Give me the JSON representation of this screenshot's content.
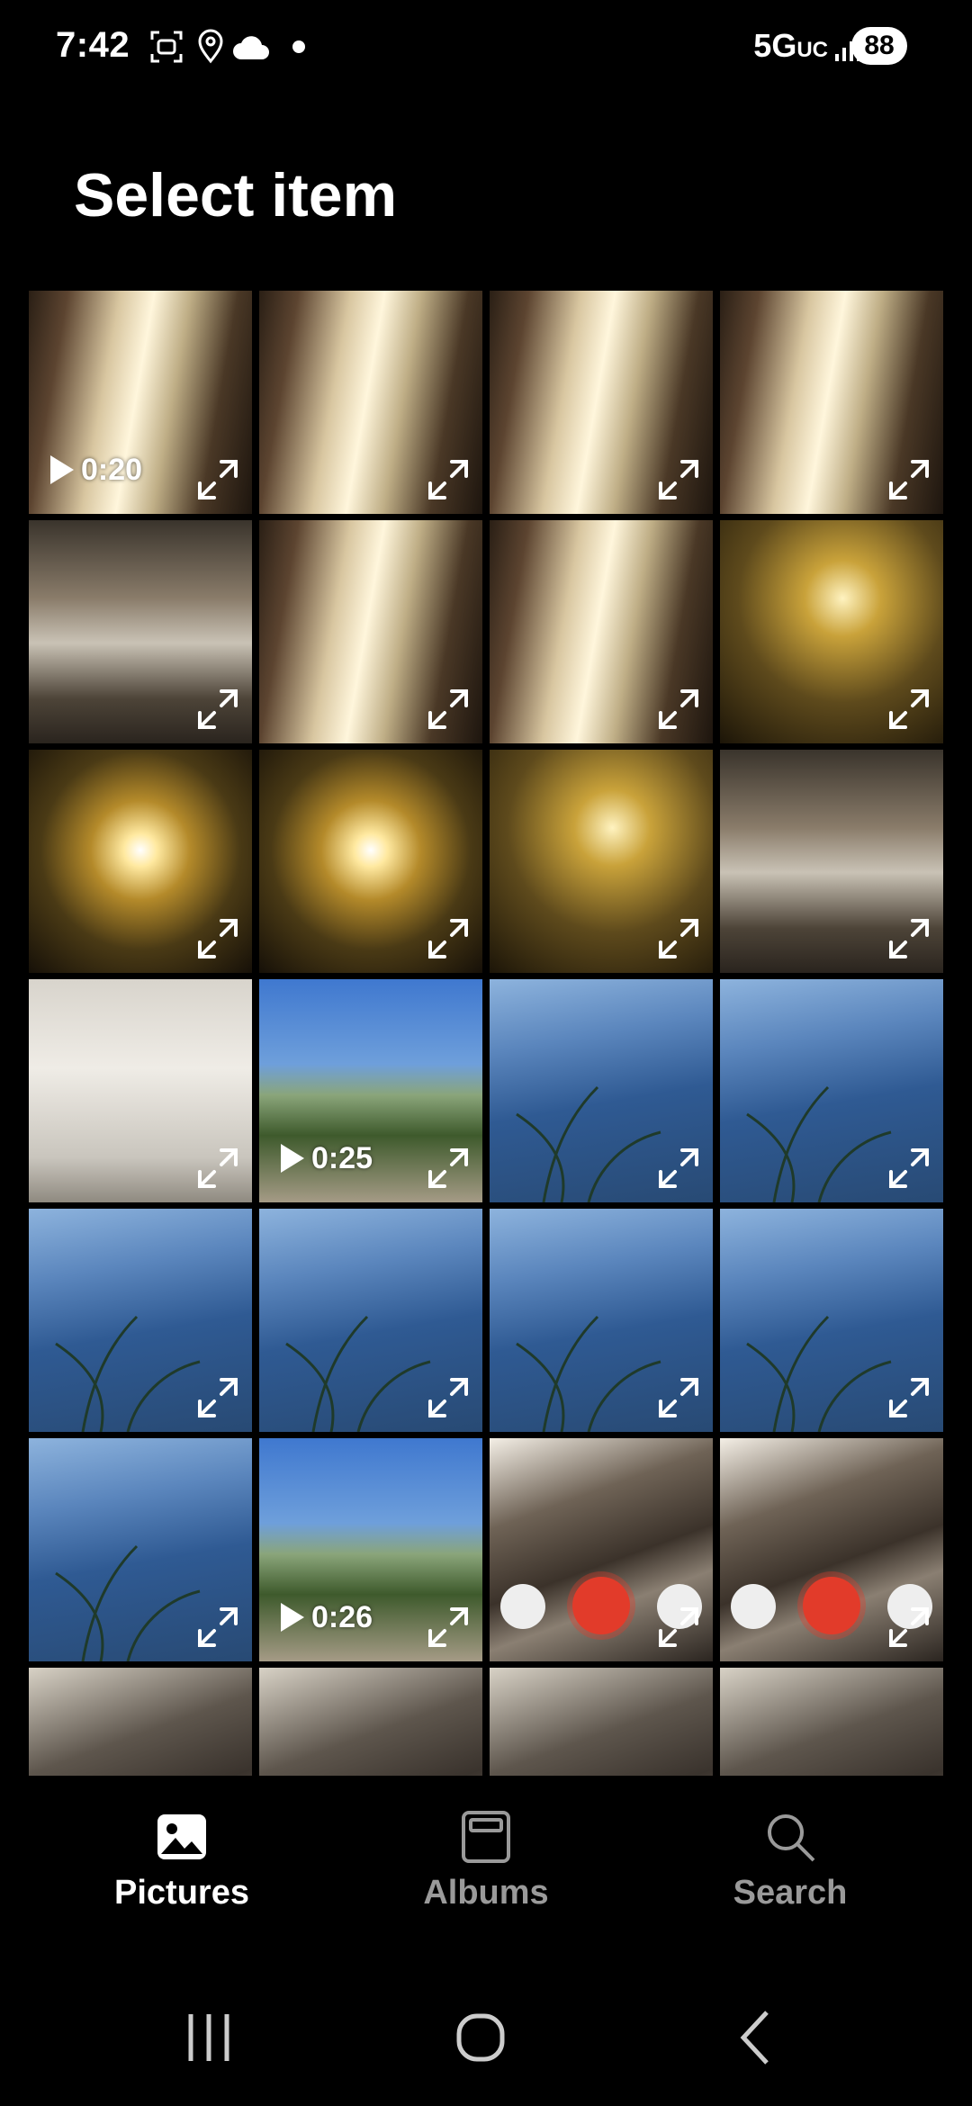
{
  "status_bar": {
    "time": "7:42",
    "icons": [
      "screenshot-icon",
      "location-icon",
      "cloud-icon",
      "dot-icon"
    ],
    "network": "5G",
    "network_suffix": "UC",
    "battery": "88"
  },
  "page": {
    "title": "Select item"
  },
  "grid": {
    "tiles": [
      {
        "type": "video",
        "duration": "0:20",
        "scene": "window"
      },
      {
        "type": "photo",
        "scene": "window"
      },
      {
        "type": "photo",
        "scene": "window"
      },
      {
        "type": "photo",
        "scene": "window"
      },
      {
        "type": "photo",
        "scene": "room"
      },
      {
        "type": "photo",
        "scene": "window"
      },
      {
        "type": "photo",
        "scene": "window"
      },
      {
        "type": "photo",
        "scene": "window-gold"
      },
      {
        "type": "photo",
        "scene": "sun"
      },
      {
        "type": "photo",
        "scene": "sun"
      },
      {
        "type": "photo",
        "scene": "window-gold"
      },
      {
        "type": "photo",
        "scene": "room"
      },
      {
        "type": "photo",
        "scene": "document"
      },
      {
        "type": "video",
        "duration": "0:25",
        "scene": "landscape"
      },
      {
        "type": "photo",
        "scene": "hill"
      },
      {
        "type": "photo",
        "scene": "hill"
      },
      {
        "type": "photo",
        "scene": "hill"
      },
      {
        "type": "photo",
        "scene": "hill"
      },
      {
        "type": "photo",
        "scene": "hill"
      },
      {
        "type": "photo",
        "scene": "hill"
      },
      {
        "type": "photo",
        "scene": "hill"
      },
      {
        "type": "video",
        "duration": "0:26",
        "scene": "landscape"
      },
      {
        "type": "photo",
        "scene": "camera"
      },
      {
        "type": "photo",
        "scene": "camera"
      },
      {
        "type": "photo",
        "scene": "cage"
      },
      {
        "type": "photo",
        "scene": "cage"
      },
      {
        "type": "photo",
        "scene": "cage"
      },
      {
        "type": "photo",
        "scene": "cage"
      }
    ]
  },
  "bottom_nav": {
    "items": [
      {
        "label": "Pictures",
        "icon": "pictures-icon",
        "active": true
      },
      {
        "label": "Albums",
        "icon": "albums-icon",
        "active": false
      },
      {
        "label": "Search",
        "icon": "search-icon",
        "active": false
      }
    ]
  },
  "system_nav": {
    "buttons": [
      "recents-icon",
      "home-icon",
      "back-icon"
    ]
  },
  "colors": {
    "background": "#000000",
    "active": "#ffffff",
    "inactive": "#9a9a9a",
    "record": "#e23b2a"
  }
}
